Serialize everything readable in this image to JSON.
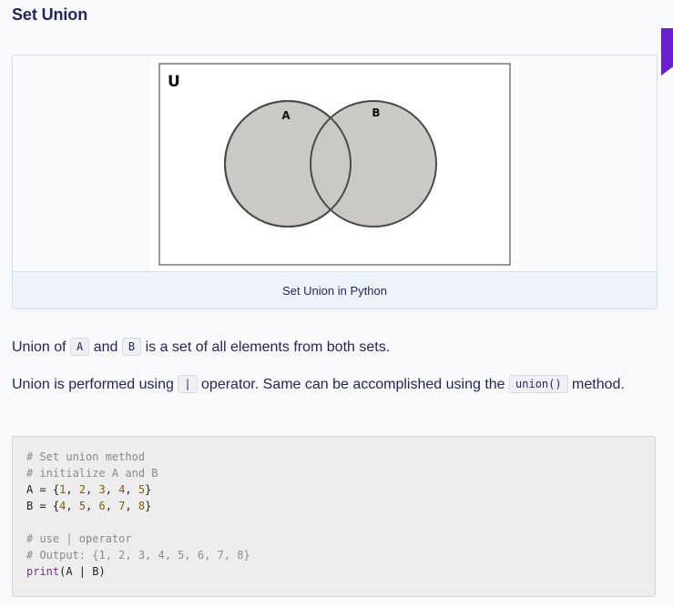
{
  "heading": "Set Union",
  "figure": {
    "diagram": {
      "universe_label": "U",
      "set_a_label": "A",
      "set_b_label": "B",
      "fill_color": "#cbc9c4",
      "stroke_color": "#4a4a4a"
    },
    "caption": "Set Union in Python"
  },
  "paragraph1": {
    "t1": "Union of",
    "code_a": "A",
    "t2": "and",
    "code_b": "B",
    "t3": "is a set of all elements from both sets."
  },
  "paragraph2": {
    "t1": "Union is performed using",
    "code_op": "|",
    "t2": "operator. Same can be accomplished using the",
    "code_method": "union()",
    "t3": "method."
  },
  "code": {
    "l1_comment": "# Set union method",
    "l2_comment": "# initialize A and B",
    "l3_head": "A = {",
    "l3_nums": [
      "1",
      "2",
      "3",
      "4",
      "5"
    ],
    "l3_tail": "}",
    "l4_head": "B = {",
    "l4_nums": [
      "4",
      "5",
      "6",
      "7",
      "8"
    ],
    "l4_tail": "}",
    "l6_comment": "# use | operator",
    "l7_comment": "# Output: {1, 2, 3, 4, 5, 6, 7, 8}",
    "l8_fn": "print",
    "l8_args": "(A | B)"
  }
}
